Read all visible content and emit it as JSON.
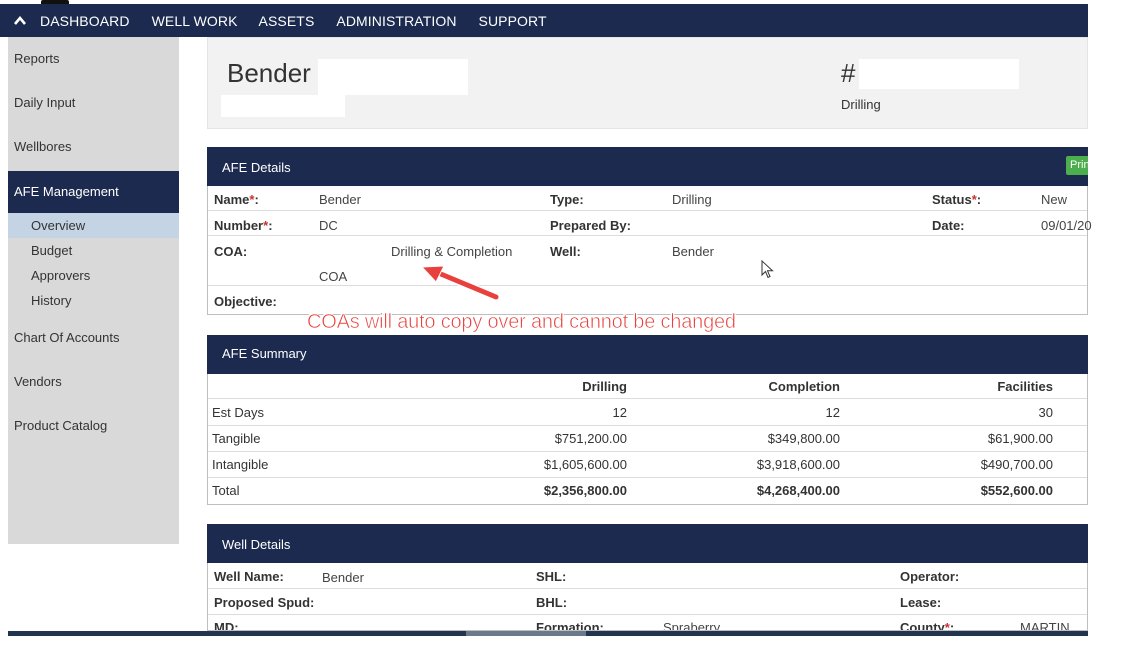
{
  "nav": {
    "items": [
      "DASHBOARD",
      "WELL WORK",
      "ASSETS",
      "ADMINISTRATION",
      "SUPPORT"
    ]
  },
  "sidebar": {
    "reports": "Reports",
    "daily_input": "Daily Input",
    "wellbores": "Wellbores",
    "afe_management": "AFE Management",
    "overview": "Overview",
    "budget": "Budget",
    "approvers": "Approvers",
    "history": "History",
    "chart_of_accounts": "Chart Of Accounts",
    "vendors": "Vendors",
    "product_catalog": "Product Catalog"
  },
  "header": {
    "title": "Bender",
    "hash": "#",
    "type": "Drilling"
  },
  "afe_details": {
    "heading": "AFE Details",
    "print_label": "Prin",
    "name_label": "Name",
    "name_value": "Bender",
    "type_label": "Type:",
    "type_value": "Drilling",
    "status_label": "Status",
    "status_value": "New",
    "number_label": "Number",
    "number_value": "DC",
    "prepared_by_label": "Prepared By:",
    "date_label": "Date:",
    "date_value": "09/01/20",
    "coa_label": "COA:",
    "coa_value_line1": "Drilling & Completion",
    "coa_value_line2": "COA",
    "well_label": "Well:",
    "well_value": "Bender",
    "objective_label": "Objective:",
    "required_mark": "*",
    "colon": ":"
  },
  "annotation": "COAs will auto copy over and cannot be changed",
  "afe_summary": {
    "heading": "AFE Summary",
    "columns": [
      "Drilling",
      "Completion",
      "Facilities"
    ],
    "rows": [
      {
        "label": "Est Days",
        "drilling": "12",
        "completion": "12",
        "facilities": "30"
      },
      {
        "label": "Tangible",
        "drilling": "$751,200.00",
        "completion": "$349,800.00",
        "facilities": "$61,900.00"
      },
      {
        "label": "Intangible",
        "drilling": "$1,605,600.00",
        "completion": "$3,918,600.00",
        "facilities": "$490,700.00"
      },
      {
        "label": "Total",
        "drilling": "$2,356,800.00",
        "completion": "$4,268,400.00",
        "facilities": "$552,600.00"
      }
    ]
  },
  "well_details": {
    "heading": "Well Details",
    "well_name_label": "Well Name:",
    "well_name_value": "Bender",
    "shl_label": "SHL:",
    "operator_label": "Operator:",
    "proposed_spud_label": "Proposed Spud:",
    "bhl_label": "BHL:",
    "lease_label": "Lease:",
    "md_label": "MD:",
    "formation_label": "Formation:",
    "formation_value": "Spraberry",
    "county_label": "County",
    "county_value": "MARTIN"
  },
  "colors": {
    "nav_bg": "#1b2a4e",
    "sidebar_bg": "#d9d9d9",
    "selected_sub": "#c5d4e5",
    "annotation": "#e8403c",
    "print_button": "#4cae4c"
  }
}
